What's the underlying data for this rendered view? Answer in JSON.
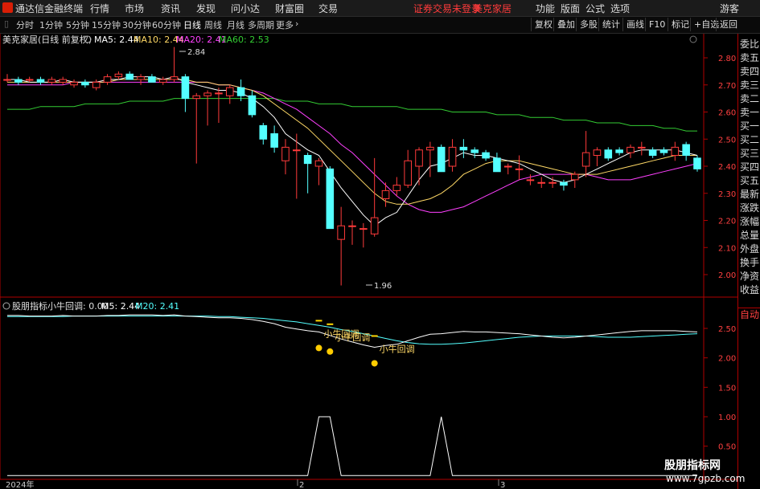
{
  "menubar": {
    "app_name": "通达信金融终端",
    "items": [
      "行情",
      "市场",
      "资讯",
      "发现",
      "问小达",
      "财富圈",
      "交易"
    ],
    "notice": "证券交易未登录",
    "stock_name": "美克家居",
    "right_items": [
      "功能",
      "版面",
      "公式",
      "选项"
    ],
    "user": "游客"
  },
  "timeframes": [
    "分时",
    "1分钟",
    "5分钟",
    "15分钟",
    "30分钟",
    "60分钟",
    "日线",
    "周线",
    "月线",
    "多周期",
    "更多"
  ],
  "active_timeframe": "日线",
  "toolbar_right": [
    "复权",
    "叠加",
    "多股",
    "统计",
    "画线",
    "F10",
    "标记",
    "+自选",
    "返回"
  ],
  "main_header": {
    "title": "美克家居(日线 前复权)",
    "ma5": "MA5: 2.44",
    "ma10": "MA10: 2.44",
    "ma20": "MA20: 2.41",
    "ma60": "MA60: 2.53"
  },
  "indicator_header": {
    "name": "股朋指标",
    "xiaoniu": "小牛回调: 0.00",
    "m5": "M5: 2.44",
    "m20": "M20: 2.41"
  },
  "annotations": {
    "high": "2.84",
    "low": "1.96",
    "signal_label": "小牛回调"
  },
  "sidebar": [
    "委比",
    "卖五",
    "卖四",
    "卖三",
    "卖二",
    "卖一",
    "买一",
    "买二",
    "买三",
    "买四",
    "买五",
    "最新",
    "涨跌",
    "涨幅",
    "总量",
    "外盘",
    "换手",
    "净资",
    "收益"
  ],
  "sidebar_auto": "自动",
  "date_axis": [
    "2024年",
    "2",
    "3"
  ],
  "watermark": {
    "line1": "股朋指标网",
    "line2": "www.7gpzb.com"
  },
  "colors": {
    "up": "#ff3b3b",
    "down": "#54ffff",
    "ma5": "#ffffff",
    "ma10": "#ffd966",
    "ma20": "#ff40ff",
    "ma60": "#33cc33",
    "frame": "#b00000"
  },
  "chart_data": [
    {
      "type": "candlestick",
      "title": "美克家居(日线 前复权)",
      "y_ticks": [
        2.8,
        2.7,
        2.6,
        2.5,
        2.4,
        2.3,
        2.2,
        2.1,
        2.0
      ],
      "ylim": [
        1.93,
        2.88
      ],
      "candles": [
        {
          "o": 2.72,
          "h": 2.74,
          "l": 2.71,
          "c": 2.72
        },
        {
          "o": 2.72,
          "h": 2.73,
          "l": 2.7,
          "c": 2.71
        },
        {
          "o": 2.72,
          "h": 2.73,
          "l": 2.71,
          "c": 2.72
        },
        {
          "o": 2.72,
          "h": 2.73,
          "l": 2.7,
          "c": 2.71
        },
        {
          "o": 2.71,
          "h": 2.73,
          "l": 2.7,
          "c": 2.72
        },
        {
          "o": 2.71,
          "h": 2.73,
          "l": 2.7,
          "c": 2.72
        },
        {
          "o": 2.7,
          "h": 2.72,
          "l": 2.69,
          "c": 2.71
        },
        {
          "o": 2.71,
          "h": 2.72,
          "l": 2.69,
          "c": 2.7
        },
        {
          "o": 2.69,
          "h": 2.72,
          "l": 2.68,
          "c": 2.71
        },
        {
          "o": 2.71,
          "h": 2.74,
          "l": 2.7,
          "c": 2.73
        },
        {
          "o": 2.73,
          "h": 2.75,
          "l": 2.72,
          "c": 2.74
        },
        {
          "o": 2.74,
          "h": 2.75,
          "l": 2.72,
          "c": 2.72
        },
        {
          "o": 2.72,
          "h": 2.74,
          "l": 2.7,
          "c": 2.73
        },
        {
          "o": 2.73,
          "h": 2.74,
          "l": 2.71,
          "c": 2.71
        },
        {
          "o": 2.71,
          "h": 2.73,
          "l": 2.7,
          "c": 2.72
        },
        {
          "o": 2.72,
          "h": 2.84,
          "l": 2.71,
          "c": 2.73
        },
        {
          "o": 2.73,
          "h": 2.74,
          "l": 2.6,
          "c": 2.65
        },
        {
          "o": 2.65,
          "h": 2.67,
          "l": 2.41,
          "c": 2.66
        },
        {
          "o": 2.66,
          "h": 2.68,
          "l": 2.55,
          "c": 2.67
        },
        {
          "o": 2.67,
          "h": 2.69,
          "l": 2.56,
          "c": 2.67
        },
        {
          "o": 2.66,
          "h": 2.7,
          "l": 2.63,
          "c": 2.69
        },
        {
          "o": 2.69,
          "h": 2.72,
          "l": 2.64,
          "c": 2.66
        },
        {
          "o": 2.66,
          "h": 2.68,
          "l": 2.58,
          "c": 2.59
        },
        {
          "o": 2.55,
          "h": 2.56,
          "l": 2.48,
          "c": 2.5
        },
        {
          "o": 2.52,
          "h": 2.55,
          "l": 2.45,
          "c": 2.47
        },
        {
          "o": 2.42,
          "h": 2.5,
          "l": 2.37,
          "c": 2.47
        },
        {
          "o": 2.46,
          "h": 2.52,
          "l": 2.28,
          "c": 2.46
        },
        {
          "o": 2.44,
          "h": 2.45,
          "l": 2.3,
          "c": 2.41
        },
        {
          "o": 2.4,
          "h": 2.43,
          "l": 2.33,
          "c": 2.42
        },
        {
          "o": 2.39,
          "h": 2.4,
          "l": 2.18,
          "c": 2.17
        },
        {
          "o": 2.13,
          "h": 2.25,
          "l": 1.96,
          "c": 2.18
        },
        {
          "o": 2.18,
          "h": 2.2,
          "l": 2.11,
          "c": 2.18
        },
        {
          "o": 2.17,
          "h": 2.19,
          "l": 2.1,
          "c": 2.17
        },
        {
          "o": 2.15,
          "h": 2.43,
          "l": 2.14,
          "c": 2.21
        },
        {
          "o": 2.28,
          "h": 2.34,
          "l": 2.25,
          "c": 2.31
        },
        {
          "o": 2.31,
          "h": 2.36,
          "l": 2.29,
          "c": 2.33
        },
        {
          "o": 2.33,
          "h": 2.46,
          "l": 2.32,
          "c": 2.42
        },
        {
          "o": 2.4,
          "h": 2.47,
          "l": 2.33,
          "c": 2.46
        },
        {
          "o": 2.46,
          "h": 2.49,
          "l": 2.36,
          "c": 2.47
        },
        {
          "o": 2.47,
          "h": 2.48,
          "l": 2.38,
          "c": 2.38
        },
        {
          "o": 2.4,
          "h": 2.5,
          "l": 2.38,
          "c": 2.47
        },
        {
          "o": 2.47,
          "h": 2.5,
          "l": 2.43,
          "c": 2.46
        },
        {
          "o": 2.46,
          "h": 2.47,
          "l": 2.43,
          "c": 2.45
        },
        {
          "o": 2.45,
          "h": 2.46,
          "l": 2.42,
          "c": 2.43
        },
        {
          "o": 2.43,
          "h": 2.45,
          "l": 2.38,
          "c": 2.38
        },
        {
          "o": 2.4,
          "h": 2.41,
          "l": 2.37,
          "c": 2.4
        },
        {
          "o": 2.39,
          "h": 2.44,
          "l": 2.35,
          "c": 2.39
        },
        {
          "o": 2.35,
          "h": 2.37,
          "l": 2.33,
          "c": 2.35
        },
        {
          "o": 2.34,
          "h": 2.36,
          "l": 2.32,
          "c": 2.34
        },
        {
          "o": 2.34,
          "h": 2.36,
          "l": 2.32,
          "c": 2.34
        },
        {
          "o": 2.34,
          "h": 2.35,
          "l": 2.31,
          "c": 2.33
        },
        {
          "o": 2.35,
          "h": 2.38,
          "l": 2.32,
          "c": 2.37
        },
        {
          "o": 2.4,
          "h": 2.53,
          "l": 2.36,
          "c": 2.45
        },
        {
          "o": 2.44,
          "h": 2.47,
          "l": 2.4,
          "c": 2.46
        },
        {
          "o": 2.46,
          "h": 2.47,
          "l": 2.42,
          "c": 2.43
        },
        {
          "o": 2.46,
          "h": 2.47,
          "l": 2.44,
          "c": 2.45
        },
        {
          "o": 2.45,
          "h": 2.48,
          "l": 2.43,
          "c": 2.47
        },
        {
          "o": 2.47,
          "h": 2.49,
          "l": 2.44,
          "c": 2.47
        },
        {
          "o": 2.46,
          "h": 2.47,
          "l": 2.43,
          "c": 2.44
        },
        {
          "o": 2.46,
          "h": 2.47,
          "l": 2.44,
          "c": 2.45
        },
        {
          "o": 2.44,
          "h": 2.49,
          "l": 2.42,
          "c": 2.47
        },
        {
          "o": 2.48,
          "h": 2.49,
          "l": 2.42,
          "c": 2.44
        },
        {
          "o": 2.43,
          "h": 2.44,
          "l": 2.38,
          "c": 2.39
        }
      ],
      "ma5": [
        2.72,
        2.72,
        2.71,
        2.71,
        2.71,
        2.72,
        2.71,
        2.71,
        2.71,
        2.72,
        2.72,
        2.73,
        2.73,
        2.73,
        2.72,
        2.73,
        2.71,
        2.7,
        2.69,
        2.68,
        2.68,
        2.67,
        2.65,
        2.62,
        2.58,
        2.52,
        2.49,
        2.46,
        2.44,
        2.38,
        2.32,
        2.27,
        2.22,
        2.18,
        2.21,
        2.23,
        2.29,
        2.35,
        2.4,
        2.41,
        2.43,
        2.45,
        2.44,
        2.44,
        2.43,
        2.42,
        2.41,
        2.39,
        2.37,
        2.35,
        2.34,
        2.35,
        2.37,
        2.39,
        2.41,
        2.43,
        2.45,
        2.46,
        2.46,
        2.46,
        2.46,
        2.45,
        2.44
      ],
      "ma10": [
        2.71,
        2.71,
        2.71,
        2.71,
        2.71,
        2.71,
        2.71,
        2.71,
        2.71,
        2.71,
        2.72,
        2.72,
        2.72,
        2.72,
        2.72,
        2.72,
        2.72,
        2.71,
        2.71,
        2.7,
        2.7,
        2.69,
        2.68,
        2.66,
        2.63,
        2.6,
        2.57,
        2.54,
        2.5,
        2.46,
        2.42,
        2.38,
        2.34,
        2.3,
        2.27,
        2.26,
        2.26,
        2.27,
        2.28,
        2.3,
        2.33,
        2.37,
        2.39,
        2.41,
        2.42,
        2.42,
        2.42,
        2.41,
        2.4,
        2.39,
        2.38,
        2.37,
        2.37,
        2.37,
        2.38,
        2.39,
        2.4,
        2.41,
        2.42,
        2.43,
        2.44,
        2.44,
        2.44
      ],
      "ma20": [
        2.7,
        2.7,
        2.7,
        2.7,
        2.7,
        2.7,
        2.71,
        2.71,
        2.71,
        2.71,
        2.71,
        2.71,
        2.71,
        2.71,
        2.71,
        2.71,
        2.71,
        2.71,
        2.71,
        2.7,
        2.7,
        2.69,
        2.68,
        2.67,
        2.65,
        2.63,
        2.61,
        2.58,
        2.55,
        2.52,
        2.48,
        2.45,
        2.41,
        2.37,
        2.33,
        2.29,
        2.26,
        2.24,
        2.23,
        2.23,
        2.24,
        2.25,
        2.27,
        2.29,
        2.31,
        2.33,
        2.35,
        2.36,
        2.37,
        2.37,
        2.37,
        2.37,
        2.37,
        2.36,
        2.35,
        2.35,
        2.35,
        2.36,
        2.37,
        2.38,
        2.39,
        2.4,
        2.41
      ],
      "ma60": [
        2.61,
        2.61,
        2.61,
        2.62,
        2.62,
        2.62,
        2.62,
        2.63,
        2.63,
        2.63,
        2.63,
        2.64,
        2.64,
        2.64,
        2.64,
        2.65,
        2.65,
        2.65,
        2.65,
        2.65,
        2.65,
        2.65,
        2.65,
        2.65,
        2.65,
        2.64,
        2.64,
        2.64,
        2.63,
        2.63,
        2.63,
        2.62,
        2.62,
        2.62,
        2.62,
        2.62,
        2.61,
        2.61,
        2.61,
        2.61,
        2.6,
        2.6,
        2.6,
        2.6,
        2.59,
        2.59,
        2.59,
        2.58,
        2.58,
        2.58,
        2.57,
        2.57,
        2.57,
        2.56,
        2.56,
        2.56,
        2.55,
        2.55,
        2.55,
        2.54,
        2.54,
        2.53,
        2.53
      ]
    },
    {
      "type": "line",
      "title": "股朋指标",
      "y_ticks": [
        2.5,
        2.0,
        1.5,
        1.0,
        0.5
      ],
      "ylim": [
        0.0,
        2.78
      ],
      "m5": [
        2.72,
        2.72,
        2.71,
        2.71,
        2.71,
        2.72,
        2.71,
        2.71,
        2.71,
        2.72,
        2.72,
        2.73,
        2.73,
        2.73,
        2.72,
        2.73,
        2.71,
        2.7,
        2.69,
        2.68,
        2.68,
        2.67,
        2.65,
        2.62,
        2.58,
        2.52,
        2.49,
        2.46,
        2.44,
        2.38,
        2.32,
        2.27,
        2.22,
        2.18,
        2.21,
        2.23,
        2.29,
        2.35,
        2.4,
        2.41,
        2.43,
        2.45,
        2.44,
        2.44,
        2.43,
        2.42,
        2.41,
        2.39,
        2.37,
        2.35,
        2.34,
        2.35,
        2.37,
        2.39,
        2.41,
        2.43,
        2.45,
        2.46,
        2.46,
        2.46,
        2.46,
        2.45,
        2.44
      ],
      "m20": [
        2.7,
        2.7,
        2.7,
        2.7,
        2.7,
        2.7,
        2.71,
        2.71,
        2.71,
        2.71,
        2.71,
        2.71,
        2.71,
        2.71,
        2.71,
        2.71,
        2.71,
        2.71,
        2.71,
        2.7,
        2.7,
        2.69,
        2.68,
        2.67,
        2.65,
        2.63,
        2.61,
        2.58,
        2.55,
        2.52,
        2.48,
        2.45,
        2.41,
        2.37,
        2.33,
        2.29,
        2.26,
        2.24,
        2.23,
        2.23,
        2.24,
        2.25,
        2.27,
        2.29,
        2.31,
        2.33,
        2.35,
        2.36,
        2.37,
        2.37,
        2.37,
        2.37,
        2.37,
        2.36,
        2.35,
        2.35,
        2.35,
        2.36,
        2.37,
        2.38,
        2.39,
        2.4,
        2.41
      ],
      "xiaoniu": [
        0,
        0,
        0,
        0,
        0,
        0,
        0,
        0,
        0,
        0,
        0,
        0,
        0,
        0,
        0,
        0,
        0,
        0,
        0,
        0,
        0,
        0,
        0,
        0,
        0,
        0,
        0,
        0,
        1,
        1,
        0,
        0,
        0,
        0,
        0,
        0,
        0,
        0,
        0,
        1,
        0,
        0,
        0,
        0,
        0,
        0,
        0,
        0,
        0,
        0,
        0,
        0,
        0,
        0,
        0,
        0,
        0,
        0,
        0,
        0,
        0,
        0,
        0
      ],
      "signals": [
        28,
        29,
        33
      ]
    }
  ]
}
